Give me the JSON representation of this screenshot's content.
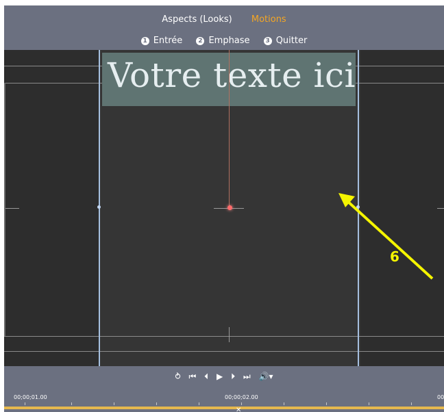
{
  "header": {
    "tabs": [
      {
        "label": "Aspects (Looks)",
        "active": false
      },
      {
        "label": "Motions",
        "active": true
      }
    ],
    "phases": [
      {
        "num": "1",
        "label": "Entrée"
      },
      {
        "num": "2",
        "label": "Emphase"
      },
      {
        "num": "3",
        "label": "Quitter"
      }
    ]
  },
  "canvas": {
    "text": "Votre texte ici",
    "annotation": "6"
  },
  "transport": {
    "buttons": [
      {
        "name": "loop-icon",
        "glyph": "⥁"
      },
      {
        "name": "go-to-start-icon",
        "glyph": "⏮"
      },
      {
        "name": "previous-frame-icon",
        "glyph": "⏴"
      },
      {
        "name": "play-icon",
        "glyph": "▶"
      },
      {
        "name": "next-frame-icon",
        "glyph": "⏵"
      },
      {
        "name": "go-to-end-icon",
        "glyph": "⏭"
      },
      {
        "name": "volume-icon",
        "glyph": "🔊▾"
      }
    ],
    "time_start": "00;00;01.00",
    "time_mid": "00;00;02.00",
    "time_end": "00"
  },
  "colors": {
    "accent": "#f5a623",
    "annotation": "#f5f500",
    "guide": "#a6c0e0"
  }
}
